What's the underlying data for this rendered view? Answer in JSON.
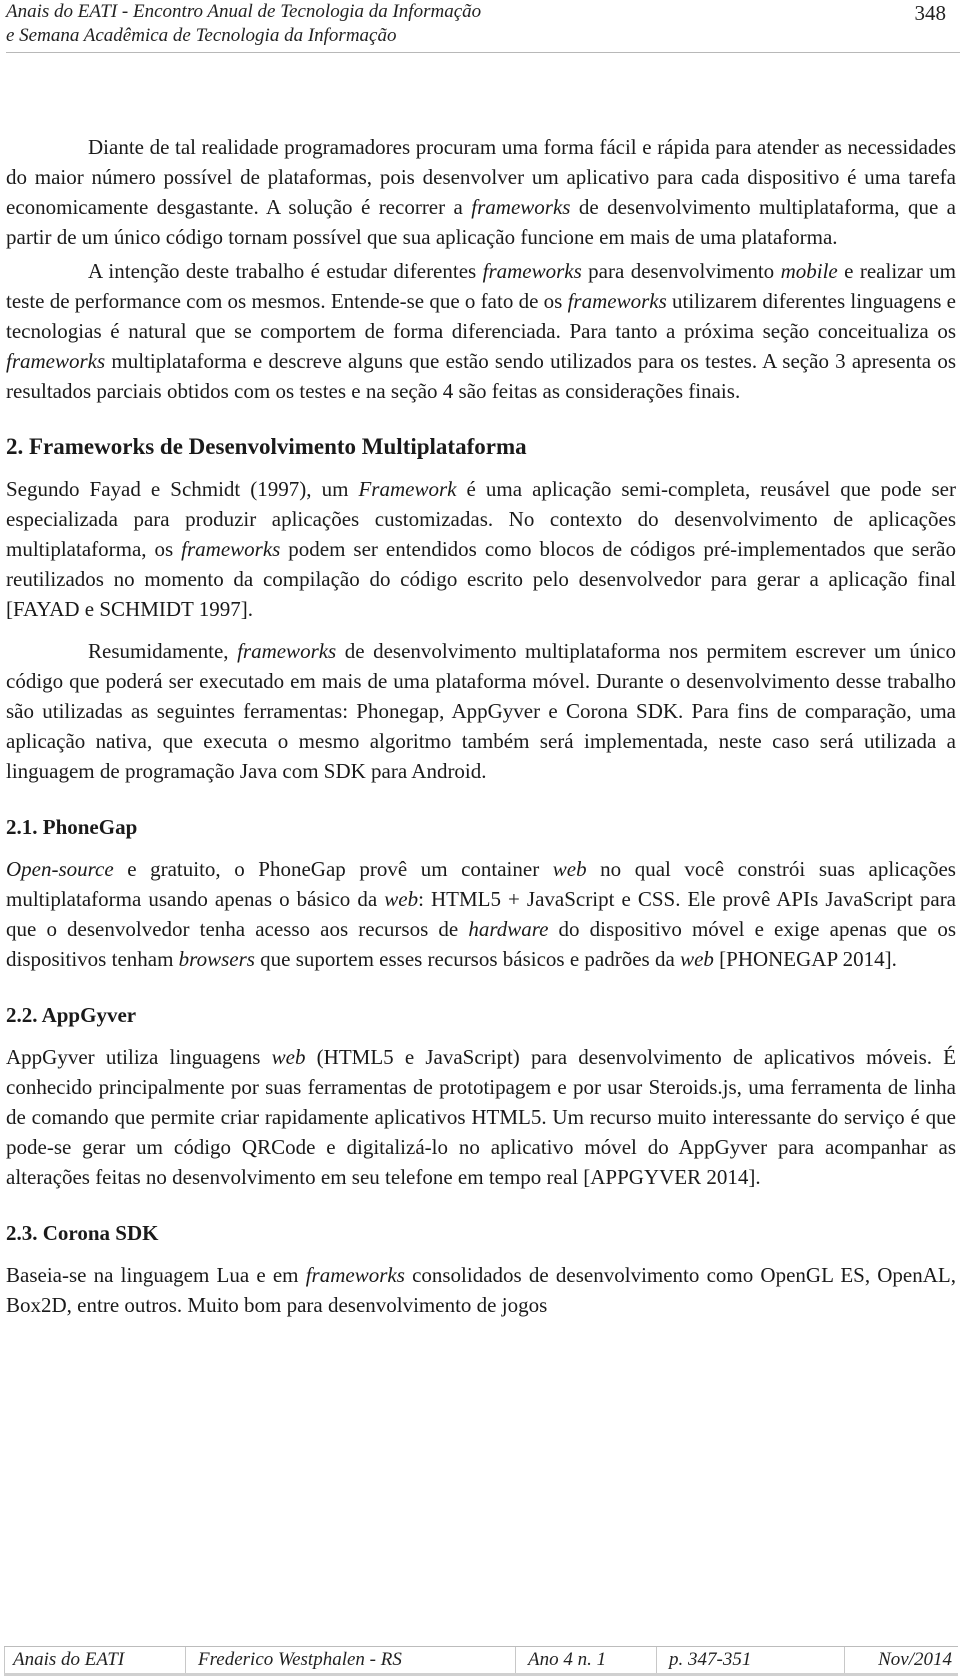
{
  "header": {
    "journal_line1": "Anais do EATI - Encontro Anual de Tecnologia da Informação",
    "journal_line2": "e Semana Acadêmica de Tecnologia da Informação",
    "page_number": "348"
  },
  "content": {
    "intro_p1": [
      {
        "t": "Diante de tal realidade programadores procuram uma forma fácil e rápida para atender as necessidades do maior número possível de plataformas, pois desenvolver um aplicativo para cada dispositivo é uma tarefa economicamente desgastante. A solução é recorrer a "
      },
      {
        "t": "frameworks",
        "i": true
      },
      {
        "t": " de desenvolvimento multiplataforma, que a partir de um único código tornam possível que sua aplicação funcione em mais de uma plataforma."
      }
    ],
    "intro_p2": [
      {
        "t": "A intenção deste trabalho é estudar diferentes "
      },
      {
        "t": "frameworks",
        "i": true
      },
      {
        "t": " para desenvolvimento "
      },
      {
        "t": "mobile",
        "i": true
      },
      {
        "t": " e realizar um teste de performance com os mesmos. Entende-se que o fato de os "
      },
      {
        "t": "frameworks",
        "i": true
      },
      {
        "t": " utilizarem diferentes linguagens e tecnologias é natural que se comportem de forma diferenciada. Para tanto a próxima seção conceitualiza os "
      },
      {
        "t": "frameworks",
        "i": true
      },
      {
        "t": " multiplataforma e descreve alguns que estão sendo utilizados para os testes. A seção 3 apresenta os resultados parciais obtidos com os testes e na seção 4 são feitas as considerações finais."
      }
    ],
    "section2_heading": "2. Frameworks de Desenvolvimento Multiplataforma",
    "section2_p1": [
      {
        "t": "Segundo Fayad e Schmidt (1997), um "
      },
      {
        "t": "Framework",
        "i": true
      },
      {
        "t": " é uma aplicação semi-completa, reusável que pode ser especializada para produzir aplicações customizadas. No contexto do desenvolvimento de aplicações multiplataforma, os "
      },
      {
        "t": "frameworks",
        "i": true
      },
      {
        "t": " podem ser entendidos como blocos de códigos pré-implementados que serão reutilizados no momento da compilação do código escrito pelo desenvolvedor para gerar a aplicação final [FAYAD e SCHMIDT 1997]."
      }
    ],
    "section2_p2": [
      {
        "t": "Resumidamente, "
      },
      {
        "t": "frameworks",
        "i": true
      },
      {
        "t": " de desenvolvimento multiplataforma nos permitem escrever um único código que poderá ser executado em mais de uma plataforma móvel. Durante o desenvolvimento desse trabalho são utilizadas as seguintes ferramentas: Phonegap, AppGyver e Corona SDK. Para fins de comparação, uma aplicação nativa, que executa o mesmo algoritmo também será implementada, neste caso será utilizada a linguagem de programação Java com SDK para Android."
      }
    ],
    "section21_heading": "2.1. PhoneGap",
    "section21_p1": [
      {
        "t": "Open-source",
        "i": true
      },
      {
        "t": " e gratuito, o PhoneGap provê um container "
      },
      {
        "t": "web",
        "i": true
      },
      {
        "t": " no qual você constrói suas aplicações multiplataforma usando apenas o básico da "
      },
      {
        "t": "web",
        "i": true
      },
      {
        "t": ": HTML5 + JavaScript e CSS. Ele provê APIs JavaScript para que o desenvolvedor tenha acesso aos recursos de "
      },
      {
        "t": "hardware",
        "i": true
      },
      {
        "t": " do dispositivo móvel e exige apenas que os dispositivos tenham "
      },
      {
        "t": "browsers",
        "i": true
      },
      {
        "t": " que suportem esses recursos básicos e padrões da "
      },
      {
        "t": "web",
        "i": true
      },
      {
        "t": " [PHONEGAP 2014]."
      }
    ],
    "section22_heading": "2.2. AppGyver",
    "section22_p1": [
      {
        "t": "AppGyver utiliza linguagens "
      },
      {
        "t": "web",
        "i": true
      },
      {
        "t": " (HTML5 e JavaScript) para desenvolvimento de aplicativos móveis. É conhecido principalmente por suas ferramentas de prototipagem e por usar Steroids.js, uma ferramenta de linha de comando que permite criar rapidamente aplicativos HTML5. Um recurso muito interessante do serviço é que pode-se gerar um código QRCode e digitalizá-lo no aplicativo móvel do AppGyver para acompanhar as alterações feitas no desenvolvimento em seu telefone em tempo real [APPGYVER 2014]."
      }
    ],
    "section23_heading": "2.3. Corona SDK",
    "section23_p1": [
      {
        "t": "Baseia-se na linguagem Lua e em "
      },
      {
        "t": "frameworks",
        "i": true
      },
      {
        "t": " consolidados de desenvolvimento como OpenGL ES, OpenAL, Box2D, entre outros. Muito bom para desenvolvimento de jogos"
      }
    ]
  },
  "footer": {
    "journal": "Anais do EATI",
    "location": "Frederico Westphalen - RS",
    "volume": "Ano 4 n. 1",
    "pages": "p. 347-351",
    "date": "Nov/2014"
  }
}
